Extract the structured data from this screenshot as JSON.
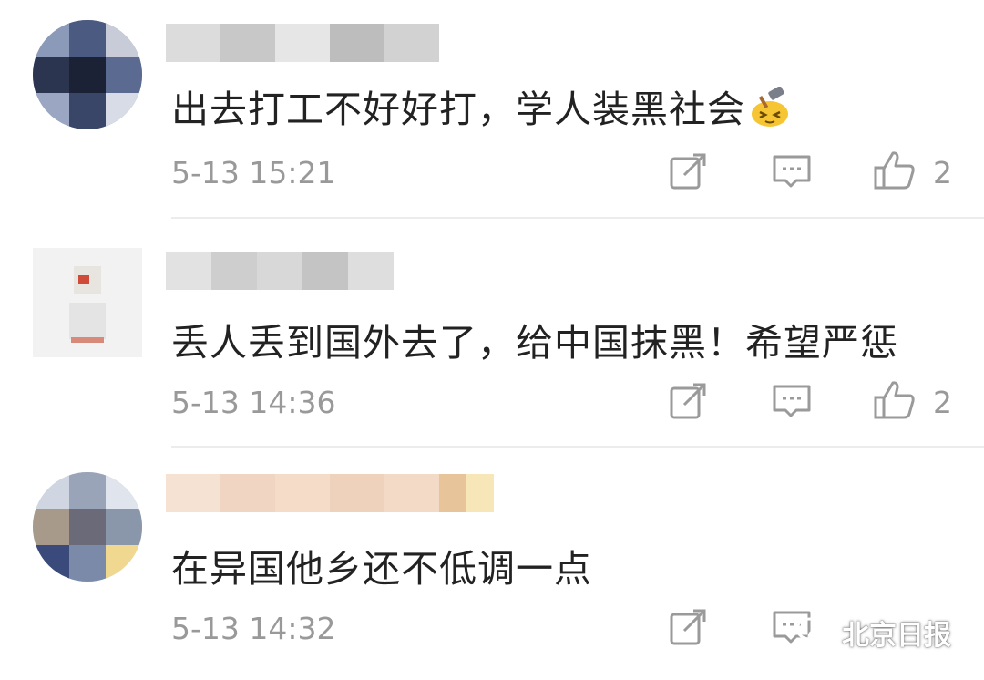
{
  "comments": [
    {
      "text": "出去打工不好好打，学人装黑社会",
      "emoji": "hammer-face-emoji",
      "time": "5-13 15:21",
      "likes": "2"
    },
    {
      "text": "丢人丢到国外去了，给中国抹黑！希望严惩",
      "time": "5-13 14:36",
      "likes": "2"
    },
    {
      "text": "在异国他乡还不低调一点",
      "time": "5-13 14:32",
      "likes": ""
    }
  ],
  "icons": {
    "share": "share-icon",
    "reply": "comment-icon",
    "like": "thumbs-up-icon"
  },
  "watermark": {
    "text": "北京日报",
    "icon": "wechat-icon"
  },
  "colors": {
    "text": "#222222",
    "meta": "#999999",
    "divider": "#ececec"
  }
}
